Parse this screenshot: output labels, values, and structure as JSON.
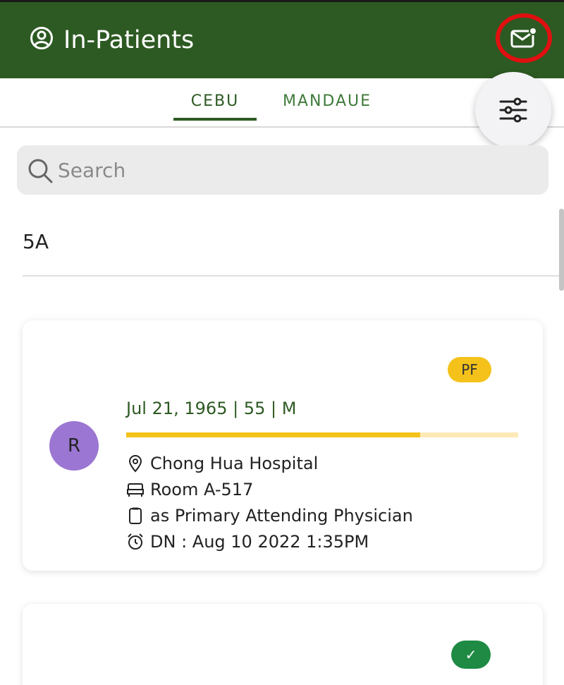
{
  "header": {
    "title": "In-Patients",
    "user_icon": "user-circle-icon",
    "mail_icon": "mail-unread-icon",
    "colors": {
      "bar": "#2d5a23",
      "highlight_ring": "#e01010"
    }
  },
  "tabs": [
    {
      "label": "CEBU",
      "active": true
    },
    {
      "label": "MANDAUE",
      "active": false
    }
  ],
  "filter_button": {
    "icon": "sliders-icon"
  },
  "search": {
    "placeholder": "Search",
    "value": ""
  },
  "ward": {
    "label": "5A"
  },
  "patients": [
    {
      "avatar_letter": "R",
      "badge": "PF",
      "dob_line": "Jul 21, 1965 | 55 | M",
      "progress": 0.75,
      "hospital": "Chong Hua Hospital",
      "room": "Room A-517",
      "role": "as Primary Attending Physician",
      "discharge": "DN : Aug 10 2022 1:35PM"
    },
    {
      "badge": "✓"
    }
  ]
}
